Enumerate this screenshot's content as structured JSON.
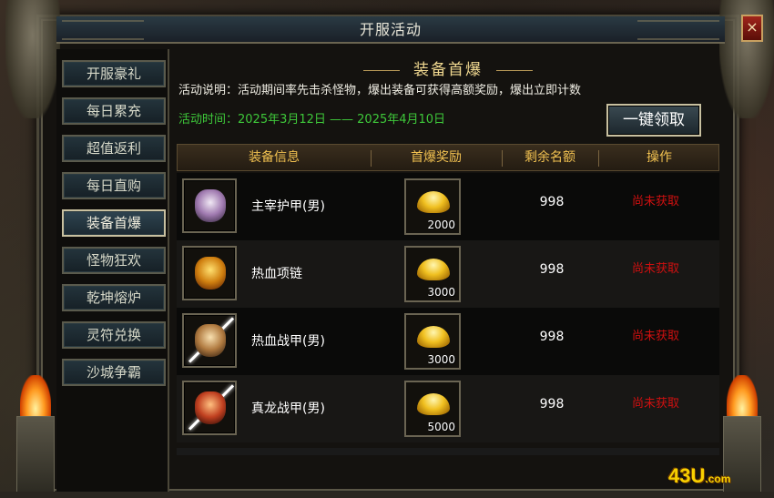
{
  "window": {
    "title": "开服活动",
    "close_label": "×"
  },
  "sidebar": {
    "items": [
      {
        "label": "开服豪礼",
        "active": false
      },
      {
        "label": "每日累充",
        "active": false
      },
      {
        "label": "超值返利",
        "active": false
      },
      {
        "label": "每日直购",
        "active": false
      },
      {
        "label": "装备首爆",
        "active": true
      },
      {
        "label": "怪物狂欢",
        "active": false
      },
      {
        "label": "乾坤熔炉",
        "active": false
      },
      {
        "label": "灵符兑换",
        "active": false
      },
      {
        "label": "沙城争霸",
        "active": false
      }
    ]
  },
  "main": {
    "section_title": "装备首爆",
    "description": "活动说明：活动期间率先击杀怪物，爆出装备可获得高额奖励，爆出立即计数",
    "time": "活动时间：2025年3月12日 —— 2025年4月10日",
    "claim_all_label": "一键领取",
    "columns": [
      "装备信息",
      "首爆奖励",
      "剩余名额",
      "操作"
    ],
    "rows": [
      {
        "name": "主宰护甲(男)",
        "reward": "2000",
        "remaining": "998",
        "status": "尚未获取",
        "icon": "armor-icon",
        "gem_color": "#c8b8d0"
      },
      {
        "name": "热血项链",
        "reward": "3000",
        "remaining": "998",
        "status": "尚未获取",
        "icon": "necklace-icon",
        "gem_color": "#e0a020"
      },
      {
        "name": "热血战甲(男)",
        "reward": "3000",
        "remaining": "998",
        "status": "尚未获取",
        "icon": "battle-armor-icon",
        "gem_color": "#d0a060"
      },
      {
        "name": "真龙战甲(男)",
        "reward": "5000",
        "remaining": "998",
        "status": "尚未获取",
        "icon": "dragon-armor-icon",
        "gem_color": "#c04020"
      }
    ],
    "reward_icon": "gold-ingot-icon",
    "status_color": "#d01010"
  },
  "logo": {
    "text": "43U",
    "suffix": ".com"
  }
}
